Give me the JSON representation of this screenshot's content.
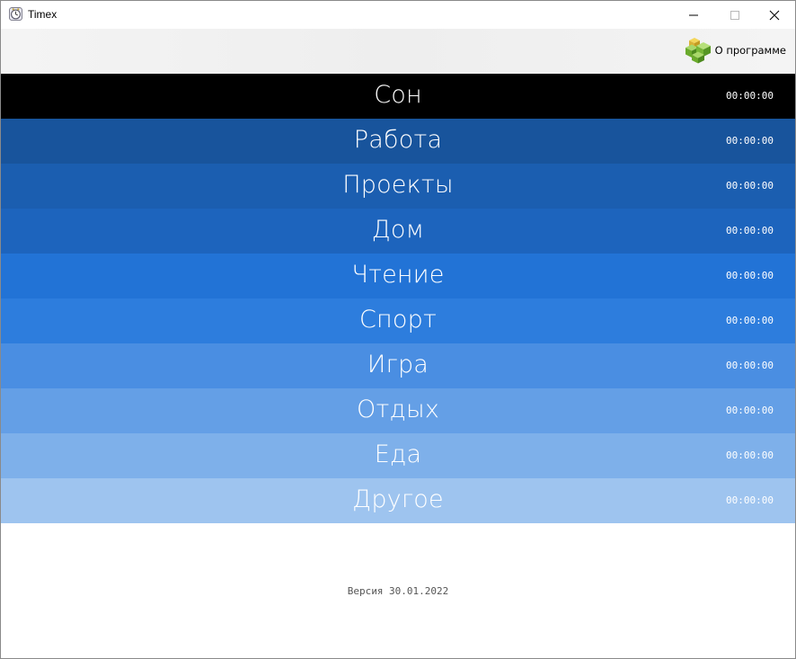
{
  "window": {
    "title": "Timex",
    "app_icon": "clock-icon",
    "controls": [
      "minimize-icon",
      "maximize-icon",
      "close-icon"
    ]
  },
  "toolbar": {
    "about_label": "О программе",
    "about_icon": "cubes-icon"
  },
  "activities": [
    {
      "name": "Сон",
      "time": "00:00:00",
      "color": "#000000"
    },
    {
      "name": "Работа",
      "time": "00:00:00",
      "color": "#18549c"
    },
    {
      "name": "Проекты",
      "time": "00:00:00",
      "color": "#1b5eb0"
    },
    {
      "name": "Дом",
      "time": "00:00:00",
      "color": "#1d64bd"
    },
    {
      "name": "Чтение",
      "time": "00:00:00",
      "color": "#2273d6"
    },
    {
      "name": "Спорт",
      "time": "00:00:00",
      "color": "#2d7ddd"
    },
    {
      "name": "Игра",
      "time": "00:00:00",
      "color": "#4a8ee2"
    },
    {
      "name": "Отдых",
      "time": "00:00:00",
      "color": "#649fe6"
    },
    {
      "name": "Еда",
      "time": "00:00:00",
      "color": "#7eb0ea"
    },
    {
      "name": "Другое",
      "time": "00:00:00",
      "color": "#9ec4ef"
    }
  ],
  "footer": {
    "version": "Версия 30.01.2022"
  }
}
